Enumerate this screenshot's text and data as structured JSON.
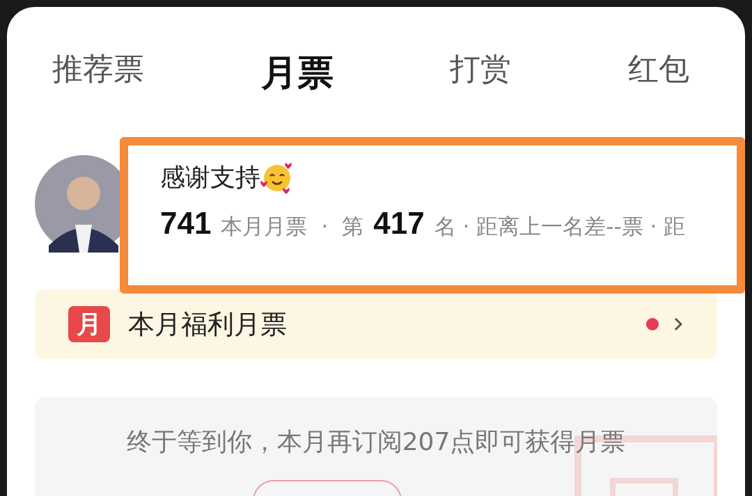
{
  "tabs": [
    {
      "label": "推荐票",
      "selected": false
    },
    {
      "label": "月票",
      "selected": true
    },
    {
      "label": "打赏",
      "selected": false
    },
    {
      "label": "红包",
      "selected": false
    }
  ],
  "highlight": {
    "title": "感谢支持",
    "votes": "741",
    "votes_label": "本月月票",
    "separator": "·",
    "rank_prefix": "第",
    "rank": "417",
    "rank_suffix": "名 · 距离上一名差--票 · 距"
  },
  "benefit": {
    "icon_label": "月",
    "label": "本月福利月票",
    "unread": true
  },
  "subscribe": {
    "message": "终于等到你，本月再订阅207点即可获得月票"
  }
}
